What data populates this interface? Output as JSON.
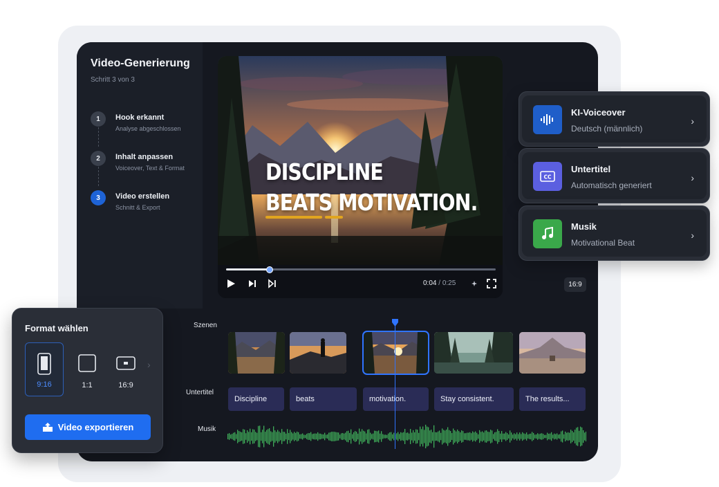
{
  "sidebar": {
    "title": "Video-Generierung",
    "subtitle": "Schritt 3 von 3",
    "steps": [
      {
        "num": "1",
        "title": "Hook erkannt",
        "desc": "Analyse abgeschlossen"
      },
      {
        "num": "2",
        "title": "Inhalt anpassen",
        "desc": "Voiceover, Text & Format"
      },
      {
        "num": "3",
        "title": "Video erstellen",
        "desc": "Schnitt & Export"
      }
    ]
  },
  "preview": {
    "caption_line1": "DISCIPLINE",
    "caption_line2": "BEATS MOTIVATION.",
    "time_current": "0:04",
    "time_separator": " / ",
    "time_total": "0:25",
    "progress": 0.16,
    "aspect_badge": "16:9"
  },
  "panels": [
    {
      "title": "KI-Voiceover",
      "subtitle": "Deutsch (männlich)",
      "icon": "waveform-icon",
      "color": "#1f5ec9"
    },
    {
      "title": "Untertitel",
      "subtitle": "Automatisch generiert",
      "icon": "cc-icon",
      "color": "#5b5fe0"
    },
    {
      "title": "Musik",
      "subtitle": "Motivational Beat",
      "icon": "music-note-icon",
      "color": "#3aa84a"
    }
  ],
  "timeline": {
    "labels": {
      "scenes": "Szenen",
      "subtitles": "Untertitel",
      "music": "Musik"
    },
    "subtitle_clips": [
      "Discipline",
      "beats",
      "motivation.",
      "Stay consistent.",
      "The results..."
    ],
    "selected_scene": 2
  },
  "format": {
    "title": "Format wählen",
    "options": [
      "9:16",
      "1:1",
      "16:9"
    ],
    "selected": "9:16",
    "export_label": "Video exportieren"
  },
  "colors": {
    "accent": "#1f6df0",
    "waveform": "#3fae5a",
    "subtitle_clip": "#2a2c56",
    "caption_underline": "#e1a51f"
  }
}
